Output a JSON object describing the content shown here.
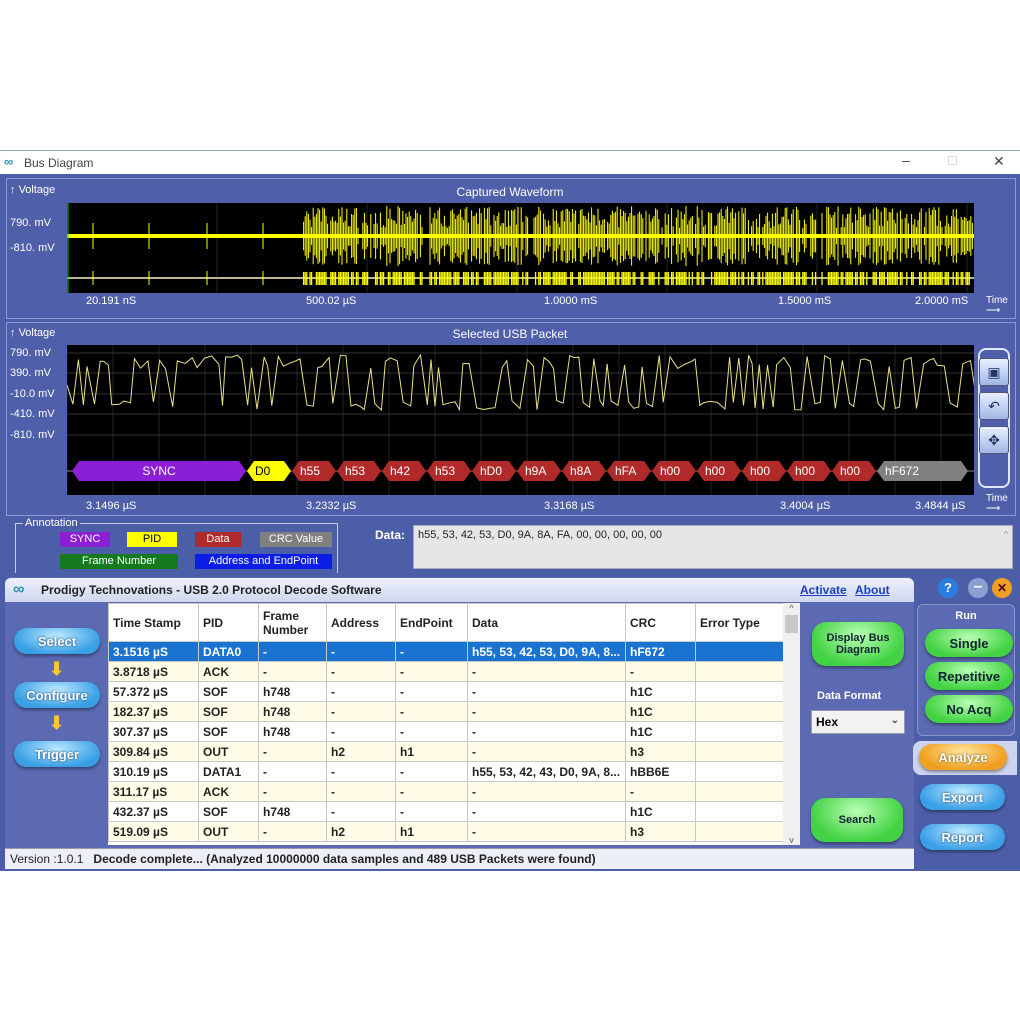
{
  "window": {
    "title": "Bus Diagram",
    "icon": "infinity-logo-icon"
  },
  "captured": {
    "title": "Captured Waveform",
    "ylabel": "Voltage",
    "xlabel": "Time",
    "yticks": [
      "790. mV",
      "-810. mV"
    ],
    "xticks": [
      "20.191 nS",
      "500.02 µS",
      "1.0000 mS",
      "1.5000 mS",
      "2.0000 mS"
    ],
    "trace_color": "#ffff00"
  },
  "packet": {
    "title": "Selected USB Packet",
    "ylabel": "Voltage",
    "xlabel": "Time",
    "yticks": [
      "790. mV",
      "390. mV",
      "-10.0 mV",
      "-410. mV",
      "-810. mV"
    ],
    "xticks": [
      "3.1496 µS",
      "3.2332 µS",
      "3.3168 µS",
      "3.4004 µS",
      "3.4844 µS"
    ],
    "segments": [
      {
        "label": "SYNC",
        "type": "sync"
      },
      {
        "label": "D0",
        "type": "pid"
      },
      {
        "label": "h55",
        "type": "data"
      },
      {
        "label": "h53",
        "type": "data"
      },
      {
        "label": "h42",
        "type": "data"
      },
      {
        "label": "h53",
        "type": "data"
      },
      {
        "label": "hD0",
        "type": "data"
      },
      {
        "label": "h9A",
        "type": "data"
      },
      {
        "label": "h8A",
        "type": "data"
      },
      {
        "label": "hFA",
        "type": "data"
      },
      {
        "label": "h00",
        "type": "data"
      },
      {
        "label": "h00",
        "type": "data"
      },
      {
        "label": "h00",
        "type": "data"
      },
      {
        "label": "h00",
        "type": "data"
      },
      {
        "label": "h00",
        "type": "data"
      },
      {
        "label": "hF672",
        "type": "crc"
      }
    ],
    "side_tools": [
      "zoom-window-icon",
      "undo-icon",
      "pan-move-icon"
    ]
  },
  "colors": {
    "sync": "#8a1fd6",
    "pid": "#ffff00",
    "data": "#b02a2a",
    "crc": "#808080",
    "frame": "#157a1e",
    "address": "#0a1ee8"
  },
  "annotation": {
    "title": "Annotation",
    "items": [
      {
        "label": "SYNC",
        "type": "sync"
      },
      {
        "label": "PID",
        "type": "pid"
      },
      {
        "label": "Data",
        "type": "data"
      },
      {
        "label": "CRC Value",
        "type": "crc"
      },
      {
        "label": "Frame Number",
        "type": "frame"
      },
      {
        "label": "Address and EndPoint",
        "type": "address"
      }
    ]
  },
  "data_field": {
    "label": "Data:",
    "value": "h55, 53, 42, 53, D0, 9A, 8A, FA, 00, 00, 00, 00, 00"
  },
  "app": {
    "title": "Prodigy Technovations  - USB 2.0 Protocol Decode Software",
    "activate": "Activate",
    "about": "About",
    "steps": [
      "Select",
      "Configure",
      "Trigger"
    ],
    "display_bus": "Display Bus Diagram",
    "data_format_label": "Data Format",
    "data_format": "Hex",
    "search": "Search",
    "run_label": "Run",
    "run": [
      "Single",
      "Repetitive",
      "No Acq"
    ],
    "analyze": "Analyze",
    "export": "Export",
    "report": "Report",
    "version": "Version :1.0.1",
    "status": "Decode complete... (Analyzed 10000000 data samples and 489 USB Packets were found)"
  },
  "table": {
    "columns": [
      "Time Stamp",
      "PID",
      "Frame Number",
      "Address",
      "EndPoint",
      "Data",
      "CRC",
      "Error Type"
    ],
    "rows": [
      [
        "3.1516 µS",
        "DATA0",
        "-",
        "-",
        "-",
        "h55, 53, 42, 53, D0, 9A, 8...",
        "hF672",
        ""
      ],
      [
        "3.8718 µS",
        "ACK",
        "-",
        "-",
        "-",
        "-",
        "-",
        ""
      ],
      [
        "57.372 µS",
        "SOF",
        "h748",
        "-",
        "-",
        "-",
        "h1C",
        ""
      ],
      [
        "182.37 µS",
        "SOF",
        "h748",
        "-",
        "-",
        "-",
        "h1C",
        ""
      ],
      [
        "307.37 µS",
        "SOF",
        "h748",
        "-",
        "-",
        "-",
        "h1C",
        ""
      ],
      [
        "309.84 µS",
        "OUT",
        "-",
        "h2",
        "h1",
        "-",
        "h3",
        ""
      ],
      [
        "310.19 µS",
        "DATA1",
        "-",
        "-",
        "-",
        "h55, 53, 42, 43, D0, 9A, 8...",
        "hBB6E",
        ""
      ],
      [
        "311.17 µS",
        "ACK",
        "-",
        "-",
        "-",
        "-",
        "-",
        ""
      ],
      [
        "432.37 µS",
        "SOF",
        "h748",
        "-",
        "-",
        "-",
        "h1C",
        ""
      ],
      [
        "519.09 µS",
        "OUT",
        "-",
        "h2",
        "h1",
        "-",
        "h3",
        ""
      ]
    ],
    "selected_row": 0
  }
}
